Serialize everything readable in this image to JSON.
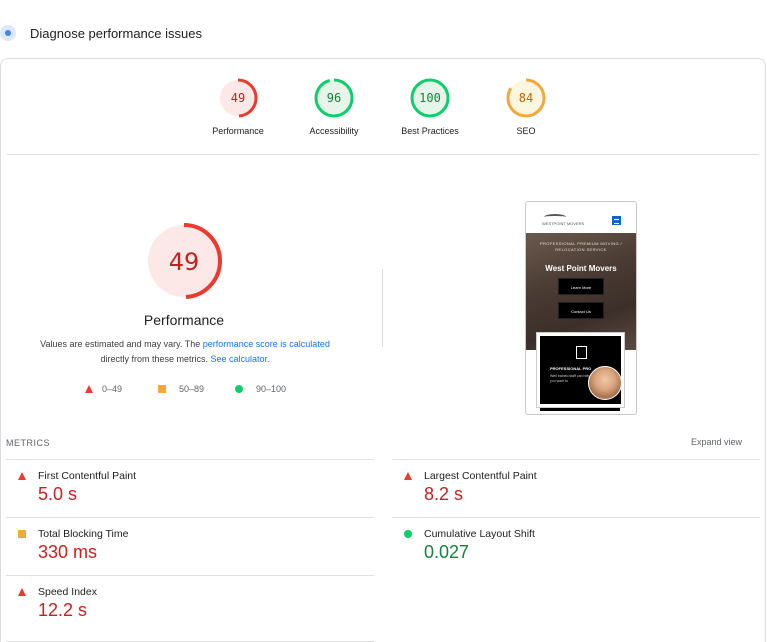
{
  "header": {
    "title": "Diagnose performance issues",
    "icon": "lighthouse-icon"
  },
  "colors": {
    "fail": "#eb3b2f",
    "average": "#f4a83b",
    "pass": "#0cce6b",
    "fail_text": "#c5221f",
    "pass_text": "#188038"
  },
  "gauges": [
    {
      "score": "49",
      "label": "Performance",
      "status": "fail"
    },
    {
      "score": "96",
      "label": "Accessibility",
      "status": "pass"
    },
    {
      "score": "100",
      "label": "Best Practices",
      "status": "pass"
    },
    {
      "score": "84",
      "label": "SEO",
      "status": "average"
    }
  ],
  "main_score": {
    "score": "49",
    "label": "Performance"
  },
  "estimate": {
    "text_before": "Values are estimated and may vary. The ",
    "link1": "performance score is calculated",
    "text_middle": " directly from these metrics. ",
    "link2": "See calculator."
  },
  "legend": [
    {
      "range": "0–49",
      "shape": "triangle"
    },
    {
      "range": "50–89",
      "shape": "square"
    },
    {
      "range": "90–100",
      "shape": "circle"
    }
  ],
  "screenshot": {
    "logo_text": "WESTPOINT MOVERS",
    "subtitle": "PROFESSIONAL PREMIUM MOVING / RELOCATION SERVICE",
    "site_name": "West Point Movers",
    "buttons": [
      "Learn More",
      "Contact Us"
    ],
    "card_title": "PROFESSIONAL PRO",
    "card_text": "Well trained staff can help\nyou want to"
  },
  "metrics": {
    "title": "METRICS",
    "expand_label": "Expand view",
    "items": [
      {
        "name": "First Contentful Paint",
        "value": "5.0 s",
        "status": "fail"
      },
      {
        "name": "Largest Contentful Paint",
        "value": "8.2 s",
        "status": "fail"
      },
      {
        "name": "Total Blocking Time",
        "value": "330 ms",
        "status": "average"
      },
      {
        "name": "Cumulative Layout Shift",
        "value": "0.027",
        "status": "pass"
      },
      {
        "name": "Speed Index",
        "value": "12.2 s",
        "status": "fail"
      }
    ]
  }
}
